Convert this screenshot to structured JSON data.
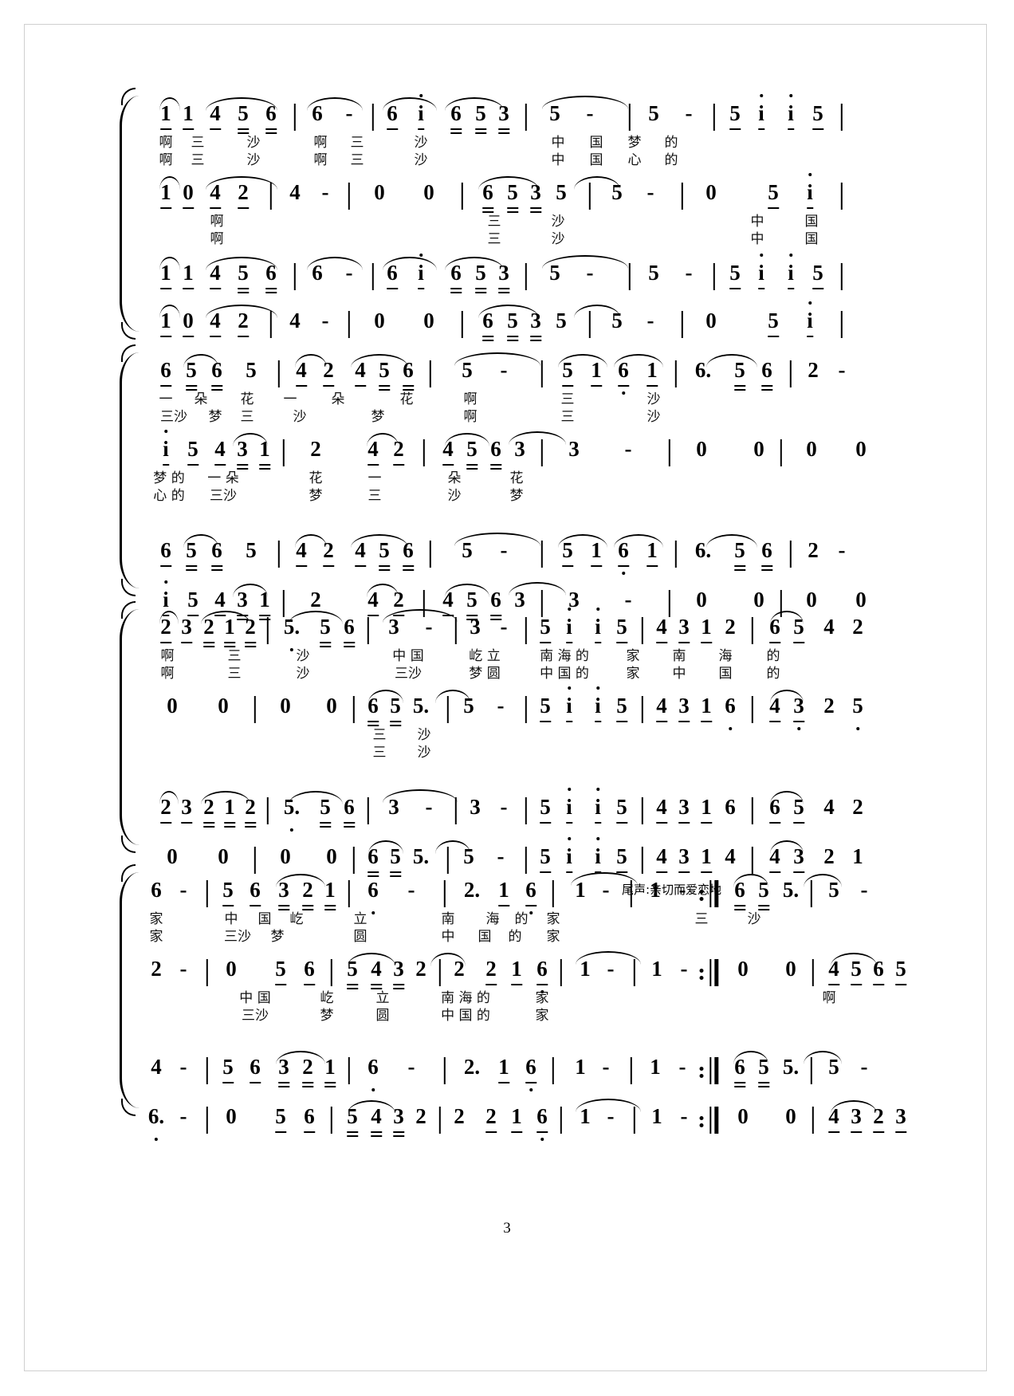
{
  "document": {
    "type": "jianpu-choral-score",
    "page_number": "3",
    "marking_text": "尾声:亲切而爱恋地"
  },
  "systems": [
    {
      "id": "system-1",
      "staves": [
        {
          "id": "s1-v1",
          "notes": [
            "1",
            "1",
            "4",
            "5",
            "6",
            "|",
            "6",
            "-",
            "|",
            "6",
            "i",
            "6",
            "5",
            "3",
            "|",
            "5",
            "-",
            "|",
            "5",
            "-",
            "|",
            "5",
            "i",
            "i",
            "5",
            "|"
          ],
          "lyrics_1": [
            "啊",
            "三",
            "沙",
            "啊",
            "三",
            "沙",
            "中",
            "国",
            "梦",
            "的"
          ],
          "lyrics_2": [
            "啊",
            "三",
            "沙",
            "啊",
            "三",
            "沙",
            "中",
            "国",
            "心",
            "的"
          ]
        },
        {
          "id": "s1-v2",
          "notes": [
            "1",
            "0",
            "4",
            "2",
            "|",
            "4",
            "-",
            "|",
            "0",
            "0",
            "|",
            "6",
            "5",
            "3",
            "5",
            "5",
            "-",
            "|",
            "0",
            "5",
            "i",
            "|"
          ],
          "lyrics_1": [
            "啊",
            "三",
            "沙",
            "中",
            "国"
          ],
          "lyrics_2": [
            "啊",
            "三",
            "沙",
            "中",
            "国"
          ]
        },
        {
          "id": "s1-v3",
          "notes": [
            "1",
            "1",
            "4",
            "5",
            "6",
            "|",
            "6",
            "-",
            "|",
            "6",
            "i",
            "6",
            "5",
            "3",
            "|",
            "5",
            "-",
            "|",
            "5",
            "-",
            "|",
            "5",
            "i",
            "i",
            "5",
            "|"
          ],
          "lyrics_1": [],
          "lyrics_2": []
        },
        {
          "id": "s1-v4",
          "notes": [
            "1",
            "0",
            "4",
            "2",
            "|",
            "4",
            "-",
            "|",
            "0",
            "0",
            "|",
            "6",
            "5",
            "3",
            "5",
            "5",
            "-",
            "|",
            "0",
            "5",
            "i",
            "|"
          ],
          "lyrics_1": [],
          "lyrics_2": []
        }
      ]
    },
    {
      "id": "system-2",
      "staves": [
        {
          "id": "s2-v1",
          "notes": [
            "6",
            "5",
            "6",
            "5",
            "|",
            "4",
            "2",
            "4",
            "5",
            "6",
            "|",
            "5",
            "-",
            "|",
            "5",
            "1",
            "6",
            "1",
            "|",
            "6.",
            "5",
            "6",
            "|",
            "2",
            "-",
            "|"
          ],
          "lyrics_1": [
            "一",
            "朵",
            "花",
            "一",
            "朵",
            "花",
            "啊",
            "三",
            "沙"
          ],
          "lyrics_2": [
            "三沙",
            "梦",
            "三",
            "沙",
            "梦",
            "啊",
            "三",
            "沙"
          ]
        },
        {
          "id": "s2-v2",
          "notes": [
            "i",
            "5",
            "4",
            "3",
            "1",
            "|",
            "2",
            "4",
            "2",
            "|",
            "4",
            "5",
            "6",
            "3",
            "|",
            "3",
            "-",
            "|",
            "0",
            "0",
            "|",
            "0",
            "0",
            "|"
          ],
          "lyrics_1": [
            "梦 的",
            "一 朵",
            "花",
            "一",
            "朵",
            "花"
          ],
          "lyrics_2": [
            "心 的",
            "三沙",
            "梦",
            "三",
            "沙",
            "梦"
          ]
        },
        {
          "id": "s2-v3",
          "notes": [
            "6",
            "5",
            "6",
            "5",
            "|",
            "4",
            "2",
            "4",
            "5",
            "6",
            "|",
            "5",
            "-",
            "|",
            "5",
            "1",
            "6",
            "1",
            "|",
            "6.",
            "5",
            "6",
            "|",
            "2",
            "-",
            "|"
          ],
          "lyrics_1": [],
          "lyrics_2": []
        },
        {
          "id": "s2-v4",
          "notes": [
            "i",
            "5",
            "4",
            "3",
            "1",
            "|",
            "2",
            "4",
            "2",
            "|",
            "4",
            "5",
            "6",
            "3",
            "|",
            "3",
            "-",
            "|",
            "0",
            "0",
            "|",
            "0",
            "0",
            "|"
          ],
          "lyrics_1": [],
          "lyrics_2": []
        }
      ]
    },
    {
      "id": "system-3",
      "staves": [
        {
          "id": "s3-v1",
          "notes": [
            "2",
            "3",
            "2",
            "1",
            "2",
            "|",
            "5.",
            "5",
            "6",
            "|",
            "3",
            "-",
            "|",
            "3",
            "-",
            "|",
            "5",
            "i",
            "i",
            "5",
            "|",
            "4",
            "3",
            "1",
            "2",
            "|",
            "6",
            "5",
            "4",
            "2",
            "|"
          ],
          "lyrics_1": [
            "啊",
            "三",
            "沙",
            "中 国",
            "屹 立",
            "南 海 的",
            "家",
            "南",
            "海",
            "的"
          ],
          "lyrics_2": [
            "啊",
            "三",
            "沙",
            "三沙",
            "梦 圆",
            "中 国 的",
            "家",
            "中",
            "国",
            "的"
          ]
        },
        {
          "id": "s3-v2",
          "notes": [
            "0",
            "0",
            "|",
            "0",
            "0",
            "|",
            "6",
            "5",
            "5.",
            "5",
            "-",
            "|",
            "5",
            "i",
            "i",
            "5",
            "|",
            "4",
            "3",
            "1",
            "6",
            "|",
            "4",
            "3",
            "2",
            "5",
            "|"
          ],
          "lyrics_1": [
            "三",
            "沙"
          ],
          "lyrics_2": [
            "三",
            "沙"
          ]
        },
        {
          "id": "s3-v3",
          "notes": [
            "2",
            "3",
            "2",
            "1",
            "2",
            "|",
            "5.",
            "5",
            "6",
            "|",
            "3",
            "-",
            "|",
            "3",
            "-",
            "|",
            "5",
            "i",
            "i",
            "5",
            "|",
            "4",
            "3",
            "1",
            "6",
            "|",
            "6",
            "5",
            "4",
            "2",
            "|"
          ],
          "lyrics_1": [],
          "lyrics_2": []
        },
        {
          "id": "s3-v4",
          "notes": [
            "0",
            "0",
            "|",
            "0",
            "0",
            "|",
            "6",
            "5",
            "5.",
            "5",
            "-",
            "|",
            "5",
            "i",
            "i",
            "5",
            "|",
            "4",
            "3",
            "1",
            "4",
            "|",
            "4",
            "3",
            "2",
            "1",
            "|"
          ],
          "lyrics_1": [],
          "lyrics_2": []
        }
      ]
    },
    {
      "id": "system-4",
      "staves": [
        {
          "id": "s4-v1",
          "notes": [
            "6",
            "-",
            "|",
            "5",
            "6",
            "3",
            "2",
            "1",
            "|",
            "6.",
            "-",
            "|",
            "2.",
            "1",
            "6",
            "|",
            "1",
            "-",
            "|",
            "1",
            "-",
            ":‖",
            "6",
            "5",
            "5.",
            "|",
            "5",
            "-",
            "|"
          ],
          "lyrics_1": [
            "家",
            "中",
            "国",
            "屹",
            "立",
            "南",
            "海",
            "的",
            "家",
            "三",
            "沙"
          ],
          "lyrics_2": [
            "家",
            "三沙",
            "梦",
            "圆",
            "中",
            "国",
            "的",
            "家"
          ]
        },
        {
          "id": "s4-v2",
          "notes": [
            "2",
            "-",
            "|",
            "0",
            "5",
            "6",
            "|",
            "5",
            "4",
            "3",
            "2",
            "2",
            "2",
            "1",
            "6",
            "|",
            "1",
            "-",
            "|",
            "1",
            "-",
            ":‖",
            "0",
            "0",
            "|",
            "4",
            "5",
            "6",
            "5",
            "|"
          ],
          "lyrics_1": [
            "中 国",
            "屹",
            "立",
            "南 海 的",
            "家",
            "啊"
          ],
          "lyrics_2": [
            "三沙",
            "梦",
            "圆",
            "中 国 的",
            "家"
          ]
        },
        {
          "id": "s4-v3",
          "notes": [
            "4",
            "-",
            "|",
            "5",
            "6",
            "3",
            "2",
            "1",
            "|",
            "6.",
            "-",
            "|",
            "2.",
            "1",
            "6",
            "|",
            "1",
            "-",
            "|",
            "1",
            "-",
            ":‖",
            "6",
            "5",
            "5.",
            "|",
            "5",
            "-",
            "|"
          ],
          "lyrics_1": [],
          "lyrics_2": []
        },
        {
          "id": "s4-v4",
          "notes": [
            "6.",
            "-",
            "|",
            "0",
            "5",
            "6",
            "|",
            "5",
            "4",
            "3",
            "2",
            "2",
            "2",
            "1",
            "6",
            "|",
            "1",
            "-",
            "|",
            "1",
            "-",
            ":‖",
            "0",
            "0",
            "|",
            "4",
            "3",
            "2",
            "3",
            "|"
          ],
          "lyrics_1": [],
          "lyrics_2": []
        }
      ]
    }
  ]
}
